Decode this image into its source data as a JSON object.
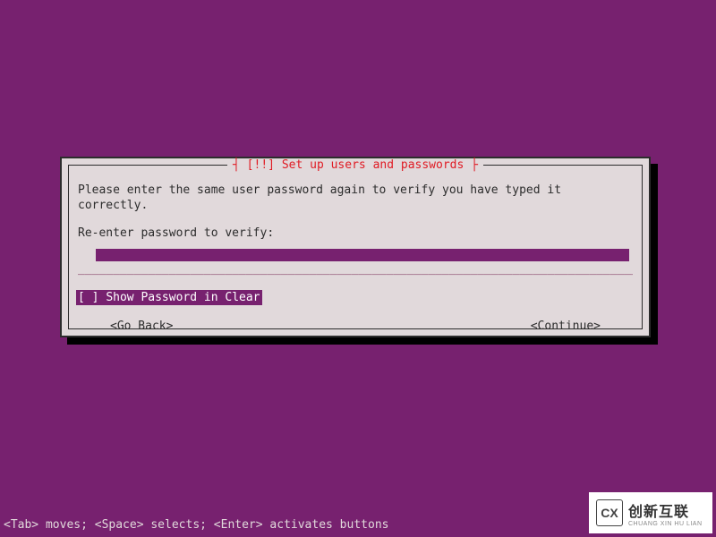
{
  "dialog": {
    "title_decorated": "┤ [!!] Set up users and passwords ├",
    "prompt": "Please enter the same user password again to verify you have typed it correctly.",
    "field_label": "Re-enter password to verify:",
    "password_value": "",
    "underline": "_____________________________________________________________________________________________",
    "checkbox": {
      "state_glyph": "[ ]",
      "label": "Show Password in Clear",
      "checked": false
    },
    "buttons": {
      "back": "<Go Back>",
      "continue": "<Continue>"
    }
  },
  "statusbar": {
    "hint": "<Tab> moves; <Space> selects; <Enter> activates buttons"
  },
  "watermark": {
    "logo_glyph": "CX",
    "brand": "创新互联",
    "sub": "CHUANG XIN HU LIAN"
  }
}
